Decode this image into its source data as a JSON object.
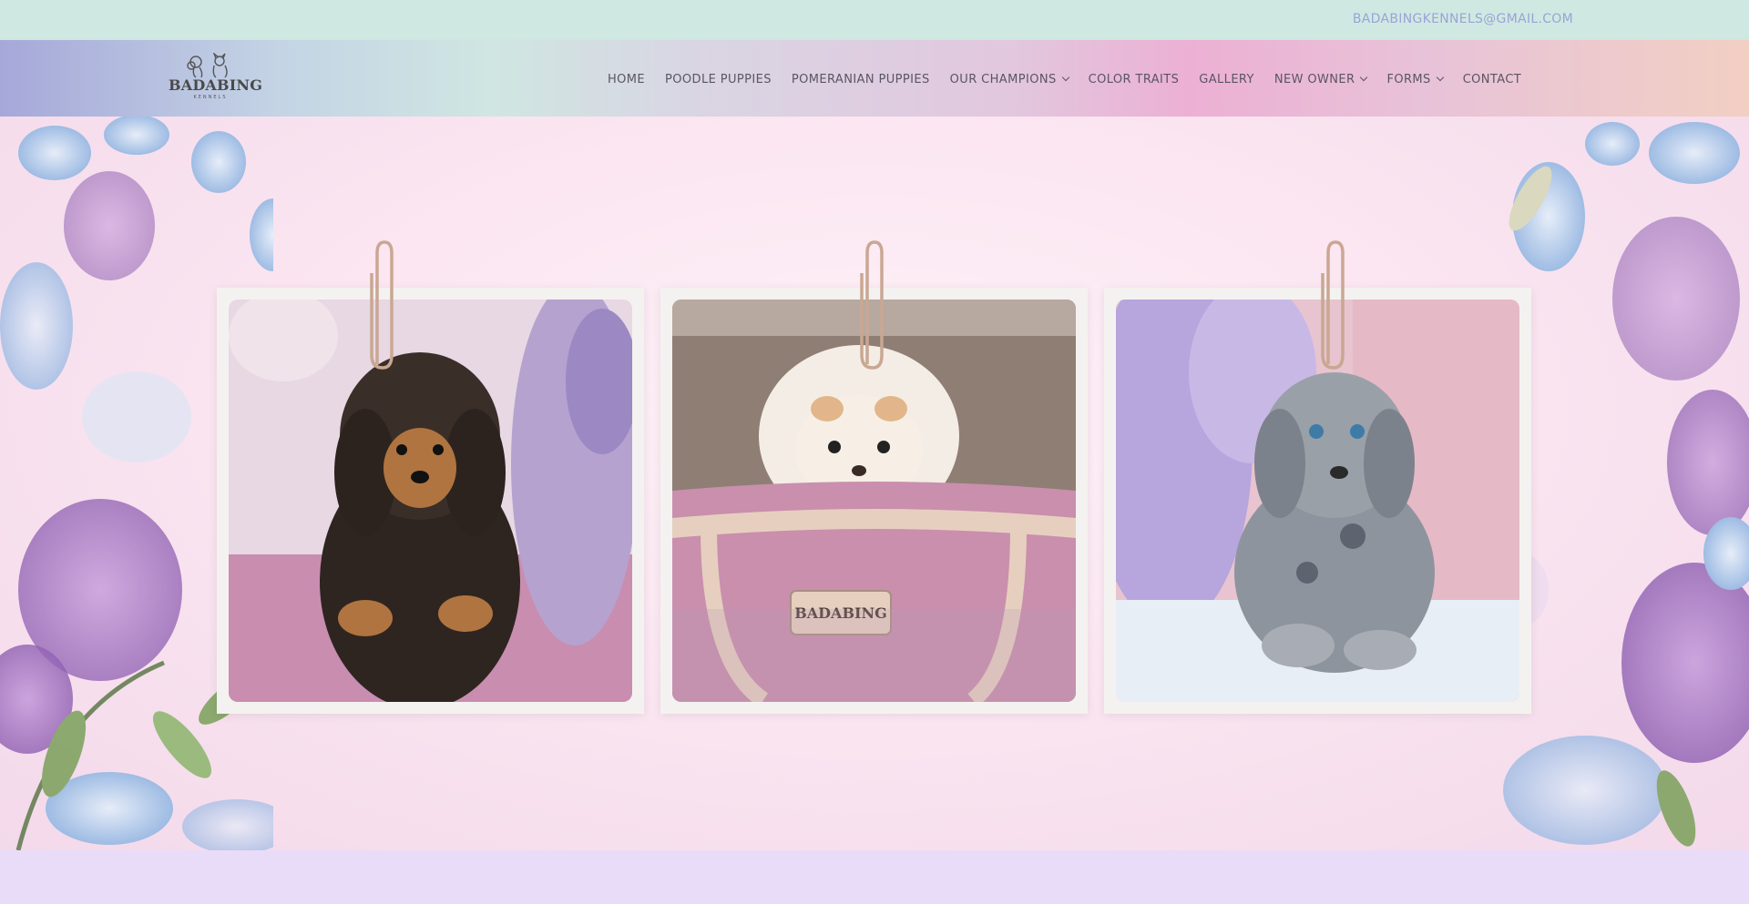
{
  "topbar": {
    "email": "BADABINGKENNELS@GMAIL.COM"
  },
  "header": {
    "logo": {
      "brand": "BADABING",
      "sub": "KENNELS"
    },
    "nav": [
      {
        "label": "HOME",
        "dropdown": false
      },
      {
        "label": "POODLE PUPPIES",
        "dropdown": false
      },
      {
        "label": "POMERANIAN PUPPIES",
        "dropdown": false
      },
      {
        "label": "OUR CHAMPIONS",
        "dropdown": true
      },
      {
        "label": "COLOR TRAITS",
        "dropdown": false
      },
      {
        "label": "GALLERY",
        "dropdown": false
      },
      {
        "label": "NEW OWNER",
        "dropdown": true
      },
      {
        "label": "FORMS",
        "dropdown": true
      },
      {
        "label": "CONTACT",
        "dropdown": false
      }
    ]
  },
  "hero": {
    "photos": [
      {
        "subject": "brown-and-black toy poodle with wisteria"
      },
      {
        "subject": "cream pomeranian puppy in pink handbag",
        "bag_label": "BADABING"
      },
      {
        "subject": "blue merle poodle puppy with wisteria"
      }
    ]
  },
  "colors": {
    "topbar": "#cfe9e2",
    "email": "#9aa3d6",
    "nav_text": "#5a5564",
    "clip": "#c9a792",
    "card": "#f4f2f0"
  }
}
